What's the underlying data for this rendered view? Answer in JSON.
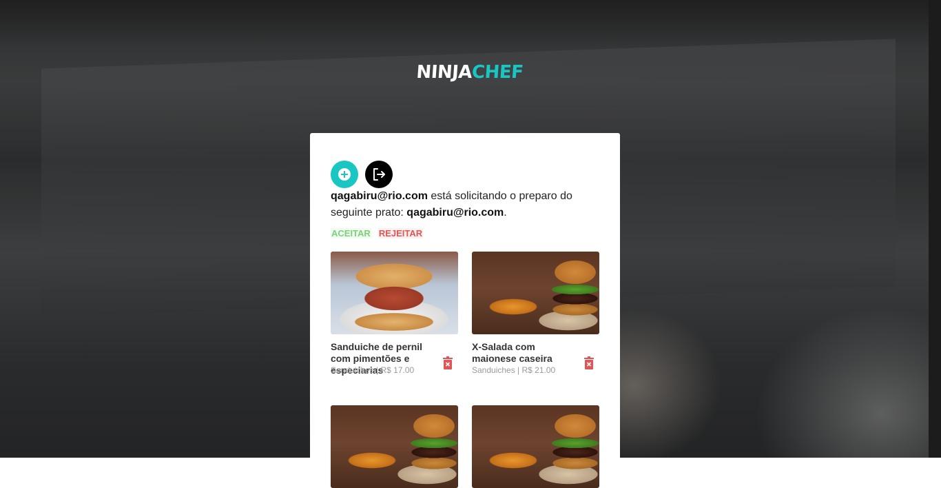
{
  "brand": {
    "part1": "NINJA",
    "part2": "CHEF"
  },
  "card": {
    "add_icon": "plus-circle-icon",
    "logout_icon": "logout-icon",
    "message": {
      "requester": "qagabiru@rio.com",
      "text_before": " está solicitando o preparo do seguinte prato: ",
      "dish": "qagabiru@rio.com",
      "text_after": "."
    },
    "accept_label": "ACEITAR",
    "reject_label": "REJEITAR",
    "items": [
      {
        "name": "Sanduiche de pernil com pimentões e especiarias",
        "meta": "Sanduiches | R$ 17.00",
        "image": "pork-sandwich"
      },
      {
        "name": "X-Salada com maionese caseira",
        "meta": "Sanduiches | R$ 21.00",
        "image": "burger-with-fries"
      },
      {
        "name": "",
        "meta": "",
        "image": "burger-with-fries"
      },
      {
        "name": "",
        "meta": "",
        "image": "burger-with-fries"
      }
    ]
  },
  "colors": {
    "accent": "#19c6c2",
    "accept": "#7dd07a",
    "reject": "#e05555"
  }
}
